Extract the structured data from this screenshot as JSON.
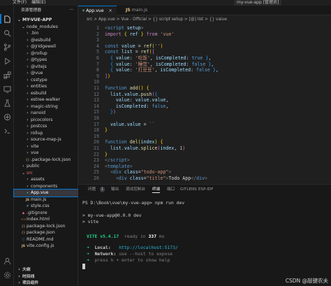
{
  "titlebar": {
    "menu": [
      "文件(F)",
      "编辑(E)"
    ],
    "title": "my-vue-app [管理员]"
  },
  "activity_icons": [
    "files-icon",
    "search-icon",
    "source-control-icon",
    "run-debug-icon",
    "extensions-icon",
    "remote-explorer-icon",
    "testing-icon",
    "docker-icon",
    "live-share-icon",
    "terminal-icon",
    "account-icon",
    "settings-icon"
  ],
  "sidebar": {
    "header": "资源管理器",
    "project": "MY-VUE-APP",
    "items": [
      {
        "label": "node_modules",
        "type": "folder",
        "open": true,
        "level": 1
      },
      {
        "label": ".bin",
        "type": "folder",
        "level": 2
      },
      {
        "label": "@esbuild",
        "type": "folder",
        "level": 2
      },
      {
        "label": "@jridgewell",
        "type": "folder",
        "level": 2
      },
      {
        "label": "@rollup",
        "type": "folder",
        "level": 2
      },
      {
        "label": "@types",
        "type": "folder",
        "level": 2
      },
      {
        "label": "@vitejs",
        "type": "folder",
        "level": 2
      },
      {
        "label": "@vue",
        "type": "folder",
        "level": 2
      },
      {
        "label": "csstype",
        "type": "folder",
        "level": 2
      },
      {
        "label": "entities",
        "type": "folder",
        "level": 2
      },
      {
        "label": "esbuild",
        "type": "folder",
        "level": 2
      },
      {
        "label": "estree-walker",
        "type": "folder",
        "level": 2
      },
      {
        "label": "magic-string",
        "type": "folder",
        "level": 2
      },
      {
        "label": "nanoid",
        "type": "folder",
        "level": 2
      },
      {
        "label": "picocolors",
        "type": "folder",
        "level": 2
      },
      {
        "label": "postcss",
        "type": "folder",
        "level": 2
      },
      {
        "label": "rollup",
        "type": "folder",
        "level": 2
      },
      {
        "label": "source-map-js",
        "type": "folder",
        "level": 2
      },
      {
        "label": "vite",
        "type": "folder",
        "level": 2
      },
      {
        "label": "vue",
        "type": "folder",
        "level": 2
      },
      {
        "label": ".package-lock.json",
        "type": "json",
        "level": 2
      },
      {
        "label": "public",
        "type": "folder",
        "level": 1
      },
      {
        "label": "src",
        "type": "folder",
        "open": true,
        "level": 1,
        "red": true
      },
      {
        "label": "assets",
        "type": "folder",
        "level": 2
      },
      {
        "label": "components",
        "type": "folder",
        "level": 2
      },
      {
        "label": "App.vue",
        "type": "vue",
        "level": 2,
        "selected": true
      },
      {
        "label": "main.js",
        "type": "js",
        "level": 2
      },
      {
        "label": "style.css",
        "type": "css",
        "level": 2
      },
      {
        "label": ".gitignore",
        "type": "git",
        "level": 1
      },
      {
        "label": "index.html",
        "type": "html",
        "level": 1
      },
      {
        "label": "package-lock.json",
        "type": "json",
        "level": 1
      },
      {
        "label": "package.json",
        "type": "json",
        "level": 1
      },
      {
        "label": "README.md",
        "type": "md",
        "level": 1
      },
      {
        "label": "vite.config.js",
        "type": "js",
        "level": 1
      }
    ],
    "bottom": [
      "大纲",
      "时间线",
      "项目组件"
    ]
  },
  "tabs": [
    {
      "label": "App.vue",
      "active": true
    },
    {
      "label": "main.js",
      "active": false
    }
  ],
  "breadcrumb": "src > App.vue > Vue - Official > {} script setup > [@] list > {} value",
  "editor_lines": [
    {
      "n": "1",
      "h": "<span class='g'>&lt;</span><span class='tg'>script</span> <span class='a'>setup</span><span class='g'>&gt;</span>"
    },
    {
      "n": "2",
      "h": "<span class='kc'>import</span> <span class='b1'>{</span> <span class='v'>ref</span> <span class='b1'>}</span> <span class='kc'>from</span> <span class='s'>'vue'</span>"
    },
    {
      "n": "3",
      "h": ""
    },
    {
      "n": "4",
      "h": "<span class='k'>const</span> <span class='v'>value</span> = <span class='f'>ref</span><span class='b1'>(</span><span class='s'>''</span><span class='b1'>)</span>"
    },
    {
      "n": "5",
      "h": "<span class='k'>const</span> <span class='v'>list</span> = <span class='f'>ref</span><span class='b1'>(</span><span class='b2'>[</span>"
    },
    {
      "n": "6",
      "h": "  <span class='b3'>{</span> <span class='v'>value</span>: <span class='s'>'吃饭'</span>, <span class='v'>isCompleted</span>: <span class='k'>true</span> <span class='b3'>}</span>,"
    },
    {
      "n": "7",
      "h": "  <span class='b3'>{</span> <span class='v'>value</span>: <span class='s'>'睡觉'</span>, <span class='v'>isCompleted</span>: <span class='k'>false</span> <span class='b3'>}</span>,"
    },
    {
      "n": "8",
      "h": "  <span class='b3'>{</span> <span class='v'>value</span>: <span class='s'>'打豆豆'</span>, <span class='v'>isCompleted</span>: <span class='k'>false</span> <span class='b3'>}</span>,"
    },
    {
      "n": "9",
      "h": "<span class='b2'>]</span><span class='b1'>)</span>"
    },
    {
      "n": "10",
      "h": ""
    },
    {
      "n": "11",
      "h": "<span class='k'>function</span> <span class='f'>add</span><span class='b1'>()</span> <span class='b1'>{</span>"
    },
    {
      "n": "12",
      "h": "  <span class='v'>list</span>.<span class='v'>value</span>.<span class='f'>push</span><span class='b2'>(</span><span class='b3'>{</span>"
    },
    {
      "n": "13",
      "h": "    <span class='v'>value</span>: <span class='v'>value</span>.<span class='v'>value</span>,"
    },
    {
      "n": "14",
      "h": "    <span class='v'>isCompleted</span>: <span class='k'>false</span>,"
    },
    {
      "n": "15",
      "h": "  <span class='b3'>}</span><span class='b2'>)</span>"
    },
    {
      "n": "16",
      "h": ""
    },
    {
      "n": "17",
      "h": "  <span class='v'>value</span>.<span class='v'>value</span> = <span class='s'>``</span>"
    },
    {
      "n": "18",
      "h": "<span class='b1'>}</span>"
    },
    {
      "n": "19",
      "h": ""
    },
    {
      "n": "20",
      "h": "<span class='k'>function</span> <span class='f'>del</span><span class='b1'>(</span><span class='v'>index</span><span class='b1'>)</span> <span class='b1'>{</span>"
    },
    {
      "n": "21",
      "h": "  <span class='v'>list</span>.<span class='v'>value</span>.<span class='f'>splice</span><span class='b2'>(</span><span class='v'>index</span>, <span class='n'>1</span><span class='b2'>)</span>"
    },
    {
      "n": "22",
      "h": "<span class='b1'>}</span>"
    },
    {
      "n": "23",
      "h": "<span class='g'>&lt;/</span><span class='tg'>script</span><span class='g'>&gt;</span>"
    },
    {
      "n": "24",
      "h": "<span class='g'>&lt;</span><span class='tg'>template</span><span class='g'>&gt;</span>"
    },
    {
      "n": "25",
      "h": "  <span class='g'>&lt;</span><span class='tg'>div</span> <span class='a'>class</span>=<span class='s'>\"todo-app\"</span><span class='g'>&gt;</span>"
    },
    {
      "n": "26",
      "h": "    <span class='g'>&lt;</span><span class='tg'>div</span> <span class='a'>class</span>=<span class='s'>\"title\"</span><span class='g'>&gt;</span>Todo App<span class='g'>&lt;/</span><span class='tg'>div</span><span class='g'>&gt;</span>"
    }
  ],
  "panel": {
    "tabs": [
      {
        "label": "问题",
        "active": false
      },
      {
        "label": "输出",
        "active": false
      },
      {
        "label": "调试控制台",
        "active": false
      },
      {
        "label": "终端",
        "active": true
      },
      {
        "label": "端口",
        "active": false
      },
      {
        "label": "GITLENS",
        "active": false
      },
      {
        "label": "ESP-IDF",
        "active": false
      }
    ],
    "badge": "1"
  },
  "terminal": {
    "prompt": "PS D:\\Book\\vue\\my-vue-app> npm run dev",
    "line1": "> my-vue-app@0.0.0 dev",
    "line2": "> vite",
    "vite_label": "VITE v5.4.17",
    "ready_label": "ready in",
    "ready_ms": "337",
    "ms_unit": "ms",
    "local_label": "Local:",
    "local_url": "http://localhost:5173/",
    "network_label": "Network:",
    "network_text": "use --host to expose",
    "help_text": "press h + enter to show help"
  },
  "watermark": "CSDN @敲键农夫"
}
